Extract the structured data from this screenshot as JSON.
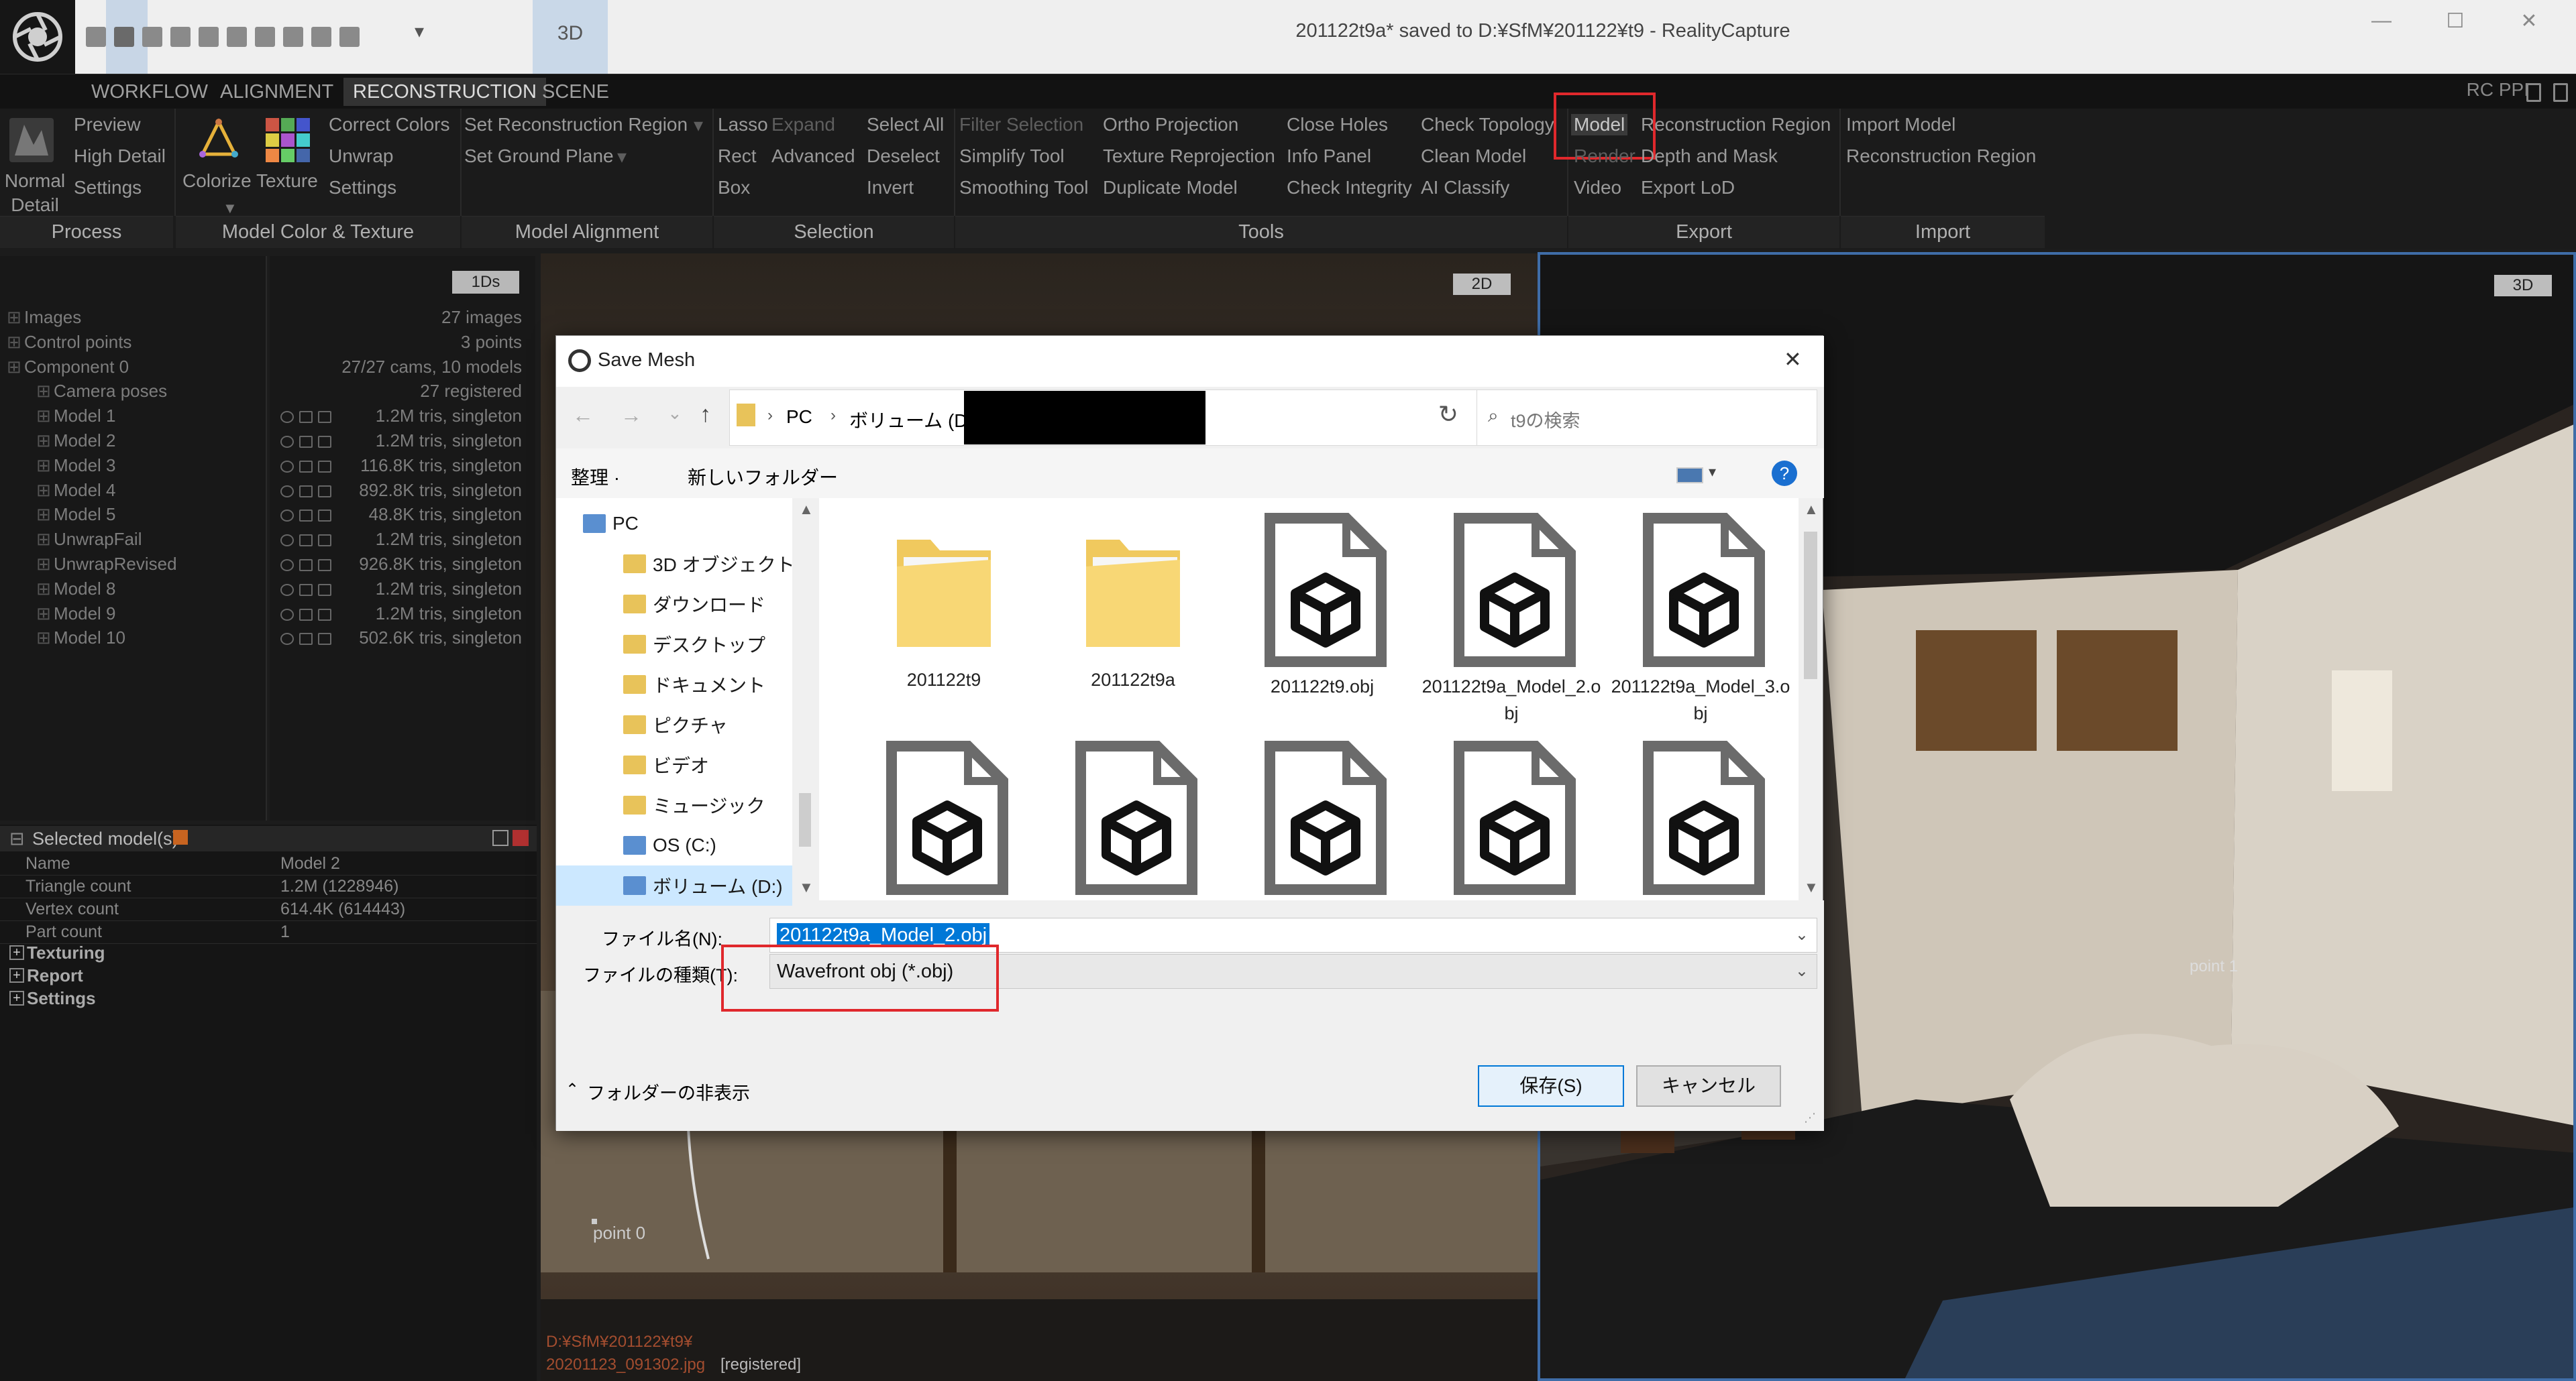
{
  "titlebar": {
    "title": "201122t9a* saved to D:¥SfM¥201122¥t9 - RealityCapture",
    "tab_3d": "3D",
    "layout_dropdown": "▾",
    "minimize": "—",
    "maximize": "☐",
    "close": "✕"
  },
  "menubar": {
    "items": [
      "WORKFLOW",
      "ALIGNMENT",
      "RECONSTRUCTION",
      "SCENE"
    ],
    "active": "RECONSTRUCTION",
    "right_label": "RC PPI"
  },
  "ribbon": {
    "process": {
      "normal_detail": "Normal Detail",
      "preview": "Preview",
      "high_detail": "High Detail",
      "settings": "Settings",
      "group": "Process"
    },
    "color": {
      "colorize_texture": "Colorize Texture",
      "correct_colors": "Correct Colors",
      "unwrap": "Unwrap",
      "settings": "Settings",
      "group": "Model Color & Texture"
    },
    "alignment": {
      "set_reconstruction_region": "Set Reconstruction Region",
      "set_ground_plane": "Set Ground Plane",
      "group": "Model Alignment"
    },
    "selection": {
      "lasso": "Lasso",
      "expand": "Expand",
      "rect": "Rect",
      "advanced": "Advanced",
      "box": "Box",
      "select_all": "Select All",
      "deselect": "Deselect",
      "invert": "Invert",
      "group": "Selection"
    },
    "tools": {
      "filter_selection": "Filter Selection",
      "simplify_tool": "Simplify Tool",
      "smoothing_tool": "Smoothing Tool",
      "ortho_projection": "Ortho Projection",
      "texture_reprojection": "Texture Reprojection",
      "duplicate_model": "Duplicate Model",
      "close_holes": "Close Holes",
      "info_panel": "Info Panel",
      "check_integrity": "Check Integrity",
      "check_topology": "Check Topology",
      "clean_model": "Clean Model",
      "ai_classify": "AI Classify",
      "group": "Tools"
    },
    "export": {
      "model": "Model",
      "reconstruction_region": "Reconstruction Region",
      "render": "Render",
      "depth_and_mask": "Depth and Mask",
      "video": "Video",
      "export_lod": "Export LoD",
      "group": "Export"
    },
    "import": {
      "import_model": "Import Model",
      "reconstruction_region": "Reconstruction Region",
      "group": "Import"
    }
  },
  "tree": {
    "badge": "1Ds",
    "items": [
      {
        "label": "Images",
        "stat": "27 images"
      },
      {
        "label": "Control points",
        "stat": "3 points"
      },
      {
        "label": "Component 0",
        "stat": "27/27 cams, 10 models"
      },
      {
        "label": "Camera poses",
        "stat": "27 registered"
      },
      {
        "label": "Model 1",
        "stat": "1.2M tris, singleton"
      },
      {
        "label": "Model 2",
        "stat": "1.2M tris, singleton"
      },
      {
        "label": "Model 3",
        "stat": "116.8K tris, singleton"
      },
      {
        "label": "Model 4",
        "stat": "892.8K tris, singleton"
      },
      {
        "label": "Model 5",
        "stat": "48.8K tris, singleton"
      },
      {
        "label": "UnwrapFail",
        "stat": "1.2M tris, singleton"
      },
      {
        "label": "UnwrapRevised",
        "stat": "926.8K tris, singleton"
      },
      {
        "label": "Model 8",
        "stat": "1.2M tris, singleton"
      },
      {
        "label": "Model 9",
        "stat": "1.2M tris, singleton"
      },
      {
        "label": "Model 10",
        "stat": "502.6K tris, singleton"
      }
    ]
  },
  "selected": {
    "header": "Selected model(s)",
    "rows": [
      {
        "k": "Name",
        "v": "Model 2"
      },
      {
        "k": "Triangle count",
        "v": "1.2M (1228946)"
      },
      {
        "k": "Vertex count",
        "v": "614.4K (614443)"
      },
      {
        "k": "Part count",
        "v": "1"
      }
    ],
    "sections": [
      "Texturing",
      "Report",
      "Settings"
    ]
  },
  "view2d": {
    "badge": "2D",
    "point0": "point 0",
    "path": "D:¥SfM¥201122¥t9¥",
    "file": "20201123_091302.jpg",
    "status": "[registered]"
  },
  "view3d": {
    "badge": "3D",
    "point1": "point 1"
  },
  "dialog": {
    "title": "Save Mesh",
    "close": "✕",
    "path": [
      "PC",
      "ボリューム (D:)"
    ],
    "search_placeholder": "t9の検索",
    "organize": "整理 ·",
    "new_folder": "新しいフォルダー",
    "help": "?",
    "nav": [
      "PC",
      "3D オブジェクト",
      "ダウンロード",
      "デスクトップ",
      "ドキュメント",
      "ピクチャ",
      "ビデオ",
      "ミュージック",
      "OS (C:)",
      "ボリューム (D:)"
    ],
    "files": [
      {
        "name": "201122t9",
        "type": "folder"
      },
      {
        "name": "201122t9a",
        "type": "folder"
      },
      {
        "name": "201122t9.obj",
        "type": "obj"
      },
      {
        "name": "201122t9a_Model_2.obj",
        "type": "obj"
      },
      {
        "name": "201122t9a_Model_3.obj",
        "type": "obj"
      },
      {
        "name": "",
        "type": "obj"
      },
      {
        "name": "",
        "type": "obj"
      },
      {
        "name": "",
        "type": "obj"
      },
      {
        "name": "",
        "type": "obj"
      },
      {
        "name": "",
        "type": "obj"
      }
    ],
    "filename_label": "ファイル名(N):",
    "filename_value": "201122t9a_Model_2.obj",
    "filetype_label": "ファイルの種類(T):",
    "filetype_value": "Wavefront obj (*.obj)",
    "hide_folders": "フォルダーの非表示",
    "save": "保存(S)",
    "cancel": "キャンセル"
  },
  "colors": {
    "accent": "#3f6da8",
    "highlight_red": "#e0282c",
    "selection_blue": "#0078d7"
  }
}
